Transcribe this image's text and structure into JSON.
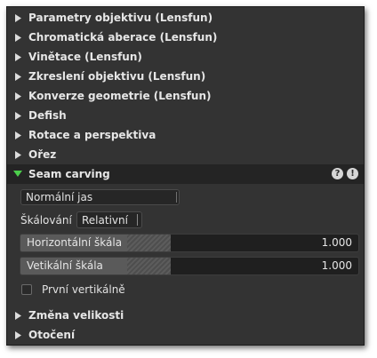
{
  "sections_top": [
    {
      "label": "Parametry objektivu (Lensfun)"
    },
    {
      "label": "Chromatická aberace (Lensfun)"
    },
    {
      "label": "Vinětace (Lensfun)"
    },
    {
      "label": "Zkreslení objektivu (Lensfun)"
    },
    {
      "label": "Konverze geometrie (Lensfun)"
    },
    {
      "label": "Defish"
    },
    {
      "label": "Rotace a perspektiva"
    },
    {
      "label": "Ořez"
    }
  ],
  "seam_carving": {
    "label": "Seam carving",
    "help_icon": "question-icon",
    "warning_icon": "exclamation-icon",
    "mode_value": "Normální jas",
    "scaling_label": "Škálování",
    "scaling_value": "Relativní",
    "horizontal_scale": {
      "label": "Horizontální škála",
      "value": "1.000"
    },
    "vertical_scale": {
      "label": "Vetikální škála",
      "value": "1.000"
    },
    "first_vertical": {
      "label": "První vertikálně",
      "checked": false
    }
  },
  "sections_bottom": [
    {
      "label": "Změna velikosti"
    },
    {
      "label": "Otočení"
    }
  ],
  "colors": {
    "panel_bg": "#333333",
    "expanded_header_bg": "#242424",
    "expanded_arrow": "#4ccf4c",
    "text": "#e6e6e6"
  }
}
